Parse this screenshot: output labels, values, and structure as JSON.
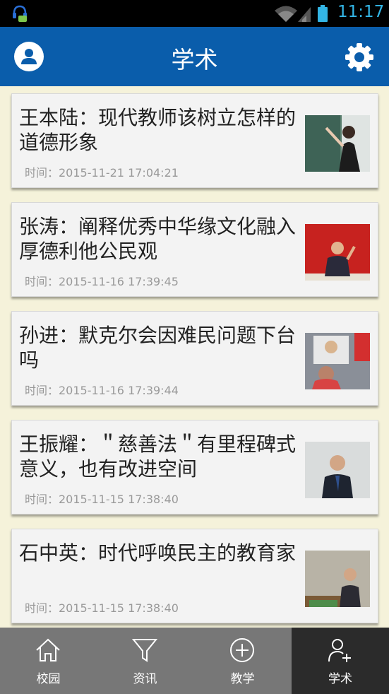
{
  "status_bar": {
    "time": "11:17",
    "icons": [
      "notification-icon",
      "wifi-icon",
      "signal-icon",
      "battery-icon"
    ],
    "accent": "#33b5e5"
  },
  "app_bar": {
    "title": "学术",
    "background": "#0a5dab",
    "left_icon": "user-avatar-icon",
    "right_icon": "gear-icon"
  },
  "articles": [
    {
      "title": "王本陆：现代教师该树立怎样的道德形象",
      "time": "时间：2015-11-21 17:04:21",
      "thumbnail": "teacher-at-blackboard-photo"
    },
    {
      "title": "张涛：阐释优秀中华缘文化融入厚德利他公民观",
      "time": "时间：2015-11-16 17:39:45",
      "thumbnail": "speaker-at-podium-photo"
    },
    {
      "title": "孙进：默克尔会因难民问题下台吗",
      "time": "时间：2015-11-16 17:39:44",
      "thumbnail": "selfie-with-merkel-photo"
    },
    {
      "title": "王振耀：＂慈善法＂有里程碑式意义，也有改进空间",
      "time": "时间：2015-11-15 17:38:40",
      "thumbnail": "man-in-suit-photo"
    },
    {
      "title": "石中英：时代呼唤民主的教育家",
      "time": "时间：2015-11-15 17:38:40",
      "thumbnail": "lecturer-at-lectern-photo"
    }
  ],
  "tab_bar": {
    "tabs": [
      {
        "label": "校园",
        "icon": "house-icon",
        "active": false
      },
      {
        "label": "资讯",
        "icon": "filter-icon",
        "active": false
      },
      {
        "label": "教学",
        "icon": "plus-circle-icon",
        "active": false
      },
      {
        "label": "学术",
        "icon": "user-add-icon",
        "active": true
      }
    ],
    "background": "#777777",
    "active_background": "#2b2b2b"
  }
}
